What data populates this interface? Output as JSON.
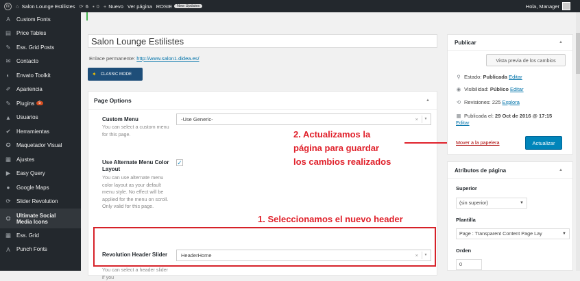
{
  "adminbar": {
    "site_name": "Salon Lounge Estilistes",
    "updates_count": "6",
    "comments_count": "0",
    "new_label": "Nuevo",
    "view_page": "Ver página",
    "rosie": "ROSIE",
    "new_updates_badge": "New Updates",
    "greeting": "Hola, Manager"
  },
  "sidebar": {
    "items": [
      {
        "icon": "A",
        "label": "Custom Fonts"
      },
      {
        "icon": "▤",
        "label": "Price Tables"
      },
      {
        "icon": "✎",
        "label": "Ess. Grid Posts"
      },
      {
        "icon": "✉",
        "label": "Contacto"
      },
      {
        "icon": "◐",
        "label": "Envato Toolkit"
      },
      {
        "icon": "✐",
        "label": "Apariencia"
      },
      {
        "icon": "✎",
        "label": "Plugins",
        "badge": "5"
      },
      {
        "icon": "▲",
        "label": "Usuarios"
      },
      {
        "icon": "✔",
        "label": "Herramientas"
      },
      {
        "icon": "✪",
        "label": "Maquetador Visual"
      },
      {
        "icon": "▦",
        "label": "Ajustes"
      },
      {
        "icon": "▶",
        "label": "Easy Query"
      },
      {
        "icon": "●",
        "label": "Google Maps"
      },
      {
        "icon": "⟳",
        "label": "Slider Revolution"
      },
      {
        "icon": "⛭",
        "label": "Ultimate Social Media Icons"
      },
      {
        "icon": "▦",
        "label": "Ess. Grid"
      },
      {
        "icon": "A",
        "label": "Punch Fonts"
      }
    ]
  },
  "editor": {
    "title": "Salon Lounge Estilistes",
    "permalink_label": "Enlace permanente:",
    "permalink_url": "http://www.salon1.didea.es/",
    "classic_mode": "CLASSIC MODE"
  },
  "page_options": {
    "heading": "Page Options",
    "custom_menu_label": "Custom Menu",
    "custom_menu_desc": "You can select a custom menu for this page.",
    "custom_menu_value": "-Use Generic-",
    "alt_menu_label": "Use Alternate Menu Color Layout",
    "alt_menu_desc": "You can use alternate menu color layout as your default menu style. No effect will be applied for the menu on scroll. Only valid for this page.",
    "alt_menu_checked": "✓",
    "rev_slider_label": "Revolution Header Slider",
    "rev_slider_desc": "You can select a header slider if you",
    "rev_slider_value": "HeaderHome"
  },
  "annotations": {
    "step2": [
      "2. Actualizamos la",
      "página para guardar",
      "los cambios realizados"
    ],
    "step1": "1. Seleccionamos el nuevo header"
  },
  "publish": {
    "heading": "Publicar",
    "preview_button": "Vista previa de los cambios",
    "status": "Estado: ",
    "status_value": "Publicada",
    "status_edit": "Editar",
    "visibility": "Visibilidad: ",
    "visibility_value": "Público",
    "visibility_edit": "Editar",
    "revisions": "Revisiones: 225",
    "revisions_link": "Explora",
    "published_on": "Publicada el: ",
    "published_date": "29 Oct de 2016 @ 17:15",
    "published_edit": "Editar",
    "trash": "Mover a la papelera",
    "update_button": "Actualizar"
  },
  "page_attributes": {
    "heading": "Atributos de página",
    "parent_label": "Superior",
    "parent_value": "(sin superior)",
    "template_label": "Plantilla",
    "template_value": "Page : Transparent Content Page Lay",
    "order_label": "Orden",
    "order_value": "0"
  },
  "colors": {
    "admin_dark": "#23282d",
    "annotation_red": "#e0202a",
    "primary_blue": "#0085ba",
    "link_blue": "#0073aa"
  }
}
